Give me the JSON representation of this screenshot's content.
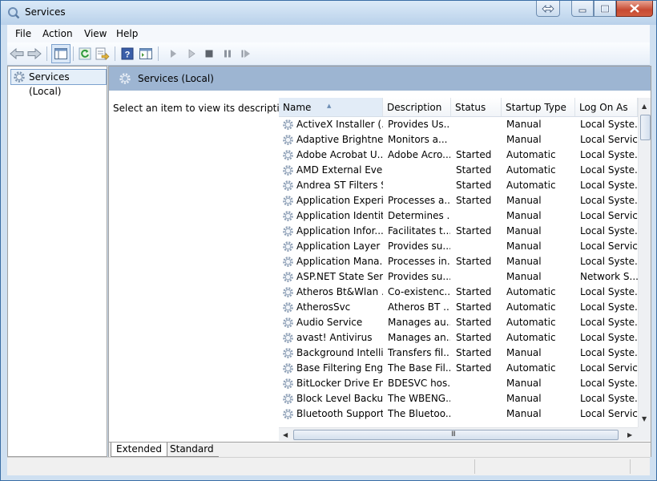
{
  "window": {
    "title": "Services"
  },
  "menu": [
    "File",
    "Action",
    "View",
    "Help"
  ],
  "tree": {
    "item": "Services (Local)"
  },
  "header": {
    "title": "Services (Local)"
  },
  "description_prompt": "Select an item to view its description.",
  "columns": {
    "name": "Name",
    "description": "Description",
    "status": "Status",
    "startup_type": "Startup Type",
    "log_on_as": "Log On As"
  },
  "services": [
    {
      "name": "ActiveX Installer (...",
      "description": "Provides Us...",
      "status": "",
      "startup": "Manual",
      "logon": "Local Syste..."
    },
    {
      "name": "Adaptive Brightness",
      "description": "Monitors a...",
      "status": "",
      "startup": "Manual",
      "logon": "Local Service"
    },
    {
      "name": "Adobe Acrobat U...",
      "description": "Adobe Acro...",
      "status": "Started",
      "startup": "Automatic",
      "logon": "Local Syste..."
    },
    {
      "name": "AMD External Eve...",
      "description": "",
      "status": "Started",
      "startup": "Automatic",
      "logon": "Local Syste..."
    },
    {
      "name": "Andrea ST Filters S...",
      "description": "",
      "status": "Started",
      "startup": "Automatic",
      "logon": "Local Syste..."
    },
    {
      "name": "Application Experi...",
      "description": "Processes a...",
      "status": "Started",
      "startup": "Manual",
      "logon": "Local Syste..."
    },
    {
      "name": "Application Identity",
      "description": "Determines ...",
      "status": "",
      "startup": "Manual",
      "logon": "Local Service"
    },
    {
      "name": "Application Infor...",
      "description": "Facilitates t...",
      "status": "Started",
      "startup": "Manual",
      "logon": "Local Syste..."
    },
    {
      "name": "Application Layer ...",
      "description": "Provides su...",
      "status": "",
      "startup": "Manual",
      "logon": "Local Service"
    },
    {
      "name": "Application Mana...",
      "description": "Processes in...",
      "status": "Started",
      "startup": "Manual",
      "logon": "Local Syste..."
    },
    {
      "name": "ASP.NET State Ser...",
      "description": "Provides su...",
      "status": "",
      "startup": "Manual",
      "logon": "Network S..."
    },
    {
      "name": "Atheros Bt&Wlan ...",
      "description": "Co-existenc...",
      "status": "Started",
      "startup": "Automatic",
      "logon": "Local Syste..."
    },
    {
      "name": "AtherosSvc",
      "description": "Atheros BT ...",
      "status": "Started",
      "startup": "Automatic",
      "logon": "Local Syste..."
    },
    {
      "name": "Audio Service",
      "description": "Manages au...",
      "status": "Started",
      "startup": "Automatic",
      "logon": "Local Syste..."
    },
    {
      "name": "avast! Antivirus",
      "description": "Manages an...",
      "status": "Started",
      "startup": "Automatic",
      "logon": "Local Syste..."
    },
    {
      "name": "Background Intelli...",
      "description": "Transfers fil...",
      "status": "Started",
      "startup": "Manual",
      "logon": "Local Syste..."
    },
    {
      "name": "Base Filtering Engi...",
      "description": "The Base Fil...",
      "status": "Started",
      "startup": "Automatic",
      "logon": "Local Service"
    },
    {
      "name": "BitLocker Drive En...",
      "description": "BDESVC hos...",
      "status": "",
      "startup": "Manual",
      "logon": "Local Syste..."
    },
    {
      "name": "Block Level Backu...",
      "description": "The WBENG...",
      "status": "",
      "startup": "Manual",
      "logon": "Local Syste..."
    },
    {
      "name": "Bluetooth Support...",
      "description": "The Bluetoo...",
      "status": "",
      "startup": "Manual",
      "logon": "Local Service"
    }
  ],
  "tabs": {
    "extended": "Extended",
    "standard": "Standard"
  },
  "scrollbar": {
    "grip": "III"
  }
}
